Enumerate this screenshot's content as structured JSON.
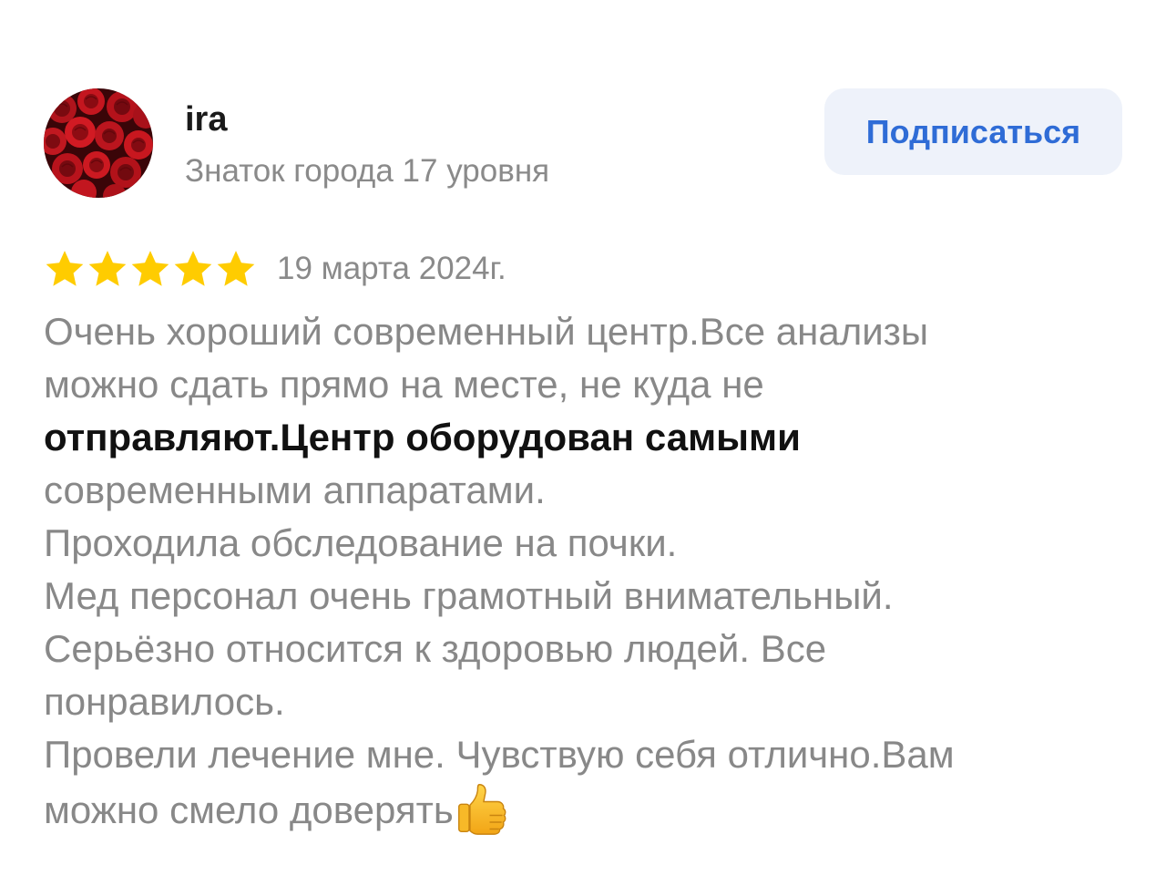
{
  "user": {
    "name": "ira",
    "level": "Знаток города 17 уровня",
    "avatar_icon": "red-roses-avatar"
  },
  "subscribe_button": {
    "label": "Подписаться"
  },
  "review": {
    "rating": 5,
    "rating_max": 5,
    "date": "19 марта 2024г.",
    "lines": [
      "Очень хороший современный центр.Все анализы",
      "можно сдать прямо на месте, не куда не",
      "отправляют.Центр оборудован самыми",
      "современными аппаратами.",
      "Проходила обследование на почки.",
      "Мед персонал очень грамотный внимательный.",
      "Серьёзно относится к здоровью людей. Все",
      "понравилось.",
      "Провели лечение мне. Чувствую себя отлично.Вам",
      "можно смело доверять"
    ],
    "trailing_emoji_icon": "thumbs-up-icon"
  },
  "colors": {
    "star": "#FFCC00",
    "button_bg": "#EEF2FA",
    "button_text": "#2F6CD6",
    "muted_text": "#888888"
  }
}
